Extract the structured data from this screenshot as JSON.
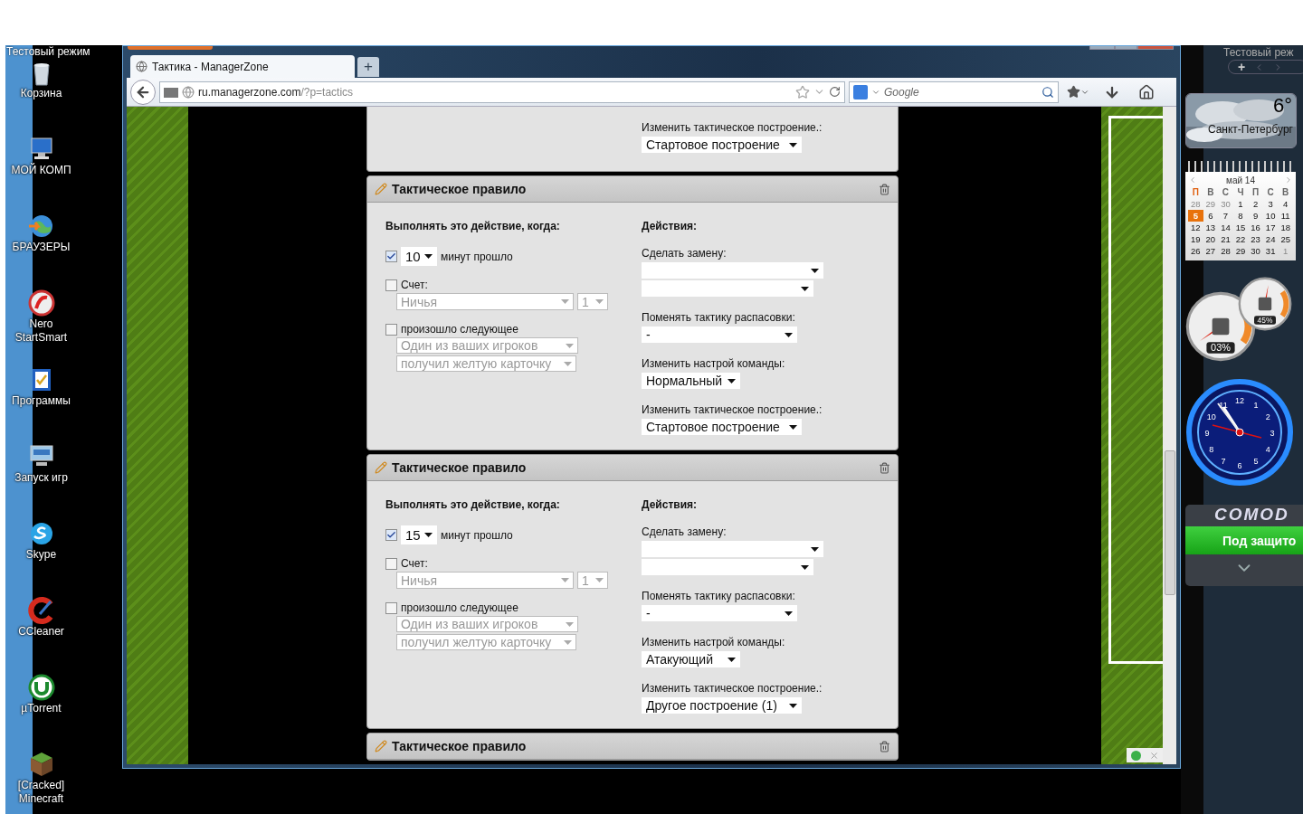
{
  "desktop": {
    "mode_label": "Тестовый режим",
    "icons": [
      {
        "kind": "trash",
        "label": "Корзина"
      },
      {
        "kind": "computer",
        "label": "МОЙ КОМП"
      },
      {
        "kind": "globe",
        "label": "БРАУЗЕРЫ"
      },
      {
        "kind": "nero",
        "label": "Nero StartSmart"
      },
      {
        "kind": "programs",
        "label": "Программы"
      },
      {
        "kind": "keyboard",
        "label": "Запуск игр"
      },
      {
        "kind": "skype",
        "label": "Skype"
      },
      {
        "kind": "ccleaner",
        "label": "CCleaner"
      },
      {
        "kind": "utorrent",
        "label": "µTorrent"
      },
      {
        "kind": "minecraft",
        "label": "[Cracked] Minecraft"
      }
    ]
  },
  "browser": {
    "tab": {
      "title": "Тактика - ManagerZone",
      "selected": true
    },
    "new_tab": "+",
    "url_host": "ru.managerzone.com",
    "url_path": "/?p=tactics",
    "search_placeholder": "Google",
    "page": {
      "partial_rule": {
        "formation_label": "Изменить тактическое построение.:",
        "formation": "Стартовое построение"
      },
      "rules": [
        {
          "title": "Тактическое правило",
          "condition_title": "Выполнять это действие, когда:",
          "minutes": {
            "checked": true,
            "value": "10",
            "suffix": "минут прошло"
          },
          "score": {
            "checked": false,
            "label": "Счет:",
            "value": "Ничья",
            "goals": "1"
          },
          "event": {
            "checked": false,
            "label": "произошло следующее",
            "who": "Один из ваших игроков",
            "what": "получил желтую карточку"
          },
          "actions_title": "Действия:",
          "sub_label": "Сделать замену:",
          "marking_label": "Поменять тактику распасовки:",
          "marking": "-",
          "mood_label": "Изменить настрой команды:",
          "mood": "Нормальный",
          "formation_label": "Изменить тактическое построение.:",
          "formation": "Стартовое построение"
        },
        {
          "title": "Тактическое правило",
          "condition_title": "Выполнять это действие, когда:",
          "minutes": {
            "checked": true,
            "value": "15",
            "suffix": "минут прошло"
          },
          "score": {
            "checked": false,
            "label": "Счет:",
            "value": "Ничья",
            "goals": "1"
          },
          "event": {
            "checked": false,
            "label": "произошло следующее",
            "who": "Один из ваших игроков",
            "what": "получил желтую карточку"
          },
          "actions_title": "Действия:",
          "sub_label": "Сделать замену:",
          "marking_label": "Поменять тактику распасовки:",
          "marking": "-",
          "mood_label": "Изменить настрой команды:",
          "mood": "Атакующий",
          "formation_label": "Изменить тактическое построение.:",
          "formation": "Другое построение (1)"
        },
        {
          "title": "Тактическое правило"
        }
      ]
    }
  },
  "gadgets": {
    "mode_label": "Тестовый реж",
    "add": "+",
    "weather": {
      "temp": "6°",
      "city": "Санкт-Петербург"
    },
    "calendar": {
      "month": "май 14",
      "weekdays": [
        {
          "label": "П",
          "selected": true
        },
        {
          "label": "В",
          "selected": false
        },
        {
          "label": "С",
          "selected": false
        },
        {
          "label": "Ч",
          "selected": false
        },
        {
          "label": "П",
          "selected": false
        },
        {
          "label": "С",
          "selected": false
        },
        {
          "label": "В",
          "selected": false
        }
      ],
      "days": [
        {
          "d": "28",
          "outside": true,
          "selected": false
        },
        {
          "d": "29",
          "outside": true,
          "selected": false
        },
        {
          "d": "30",
          "outside": true,
          "selected": false
        },
        {
          "d": "1",
          "outside": false,
          "selected": false
        },
        {
          "d": "2",
          "outside": false,
          "selected": false
        },
        {
          "d": "3",
          "outside": false,
          "selected": false
        },
        {
          "d": "4",
          "outside": false,
          "selected": false
        },
        {
          "d": "5",
          "outside": false,
          "selected": true
        },
        {
          "d": "6",
          "outside": false,
          "selected": false
        },
        {
          "d": "7",
          "outside": false,
          "selected": false
        },
        {
          "d": "8",
          "outside": false,
          "selected": false
        },
        {
          "d": "9",
          "outside": false,
          "selected": false
        },
        {
          "d": "10",
          "outside": false,
          "selected": false
        },
        {
          "d": "11",
          "outside": false,
          "selected": false
        },
        {
          "d": "12",
          "outside": false,
          "selected": false
        },
        {
          "d": "13",
          "outside": false,
          "selected": false
        },
        {
          "d": "14",
          "outside": false,
          "selected": false
        },
        {
          "d": "15",
          "outside": false,
          "selected": false
        },
        {
          "d": "16",
          "outside": false,
          "selected": false
        },
        {
          "d": "17",
          "outside": false,
          "selected": false
        },
        {
          "d": "18",
          "outside": false,
          "selected": false
        },
        {
          "d": "19",
          "outside": false,
          "selected": false
        },
        {
          "d": "20",
          "outside": false,
          "selected": false
        },
        {
          "d": "21",
          "outside": false,
          "selected": false
        },
        {
          "d": "22",
          "outside": false,
          "selected": false
        },
        {
          "d": "23",
          "outside": false,
          "selected": false
        },
        {
          "d": "24",
          "outside": false,
          "selected": false
        },
        {
          "d": "25",
          "outside": false,
          "selected": false
        },
        {
          "d": "26",
          "outside": false,
          "selected": false
        },
        {
          "d": "27",
          "outside": false,
          "selected": false
        },
        {
          "d": "28",
          "outside": false,
          "selected": false
        },
        {
          "d": "29",
          "outside": false,
          "selected": false
        },
        {
          "d": "30",
          "outside": false,
          "selected": false
        },
        {
          "d": "31",
          "outside": false,
          "selected": false
        },
        {
          "d": "1",
          "outside": true,
          "selected": false
        }
      ]
    },
    "meters": {
      "cpu": {
        "reading": "03%"
      },
      "ram": {
        "reading": "45%"
      }
    },
    "clock": {
      "numerals": [
        "12",
        "1",
        "2",
        "3",
        "4",
        "5",
        "6",
        "7",
        "8",
        "9",
        "10",
        "11"
      ]
    },
    "comodo": {
      "brand": "COMOD",
      "status": "Под защито"
    }
  }
}
